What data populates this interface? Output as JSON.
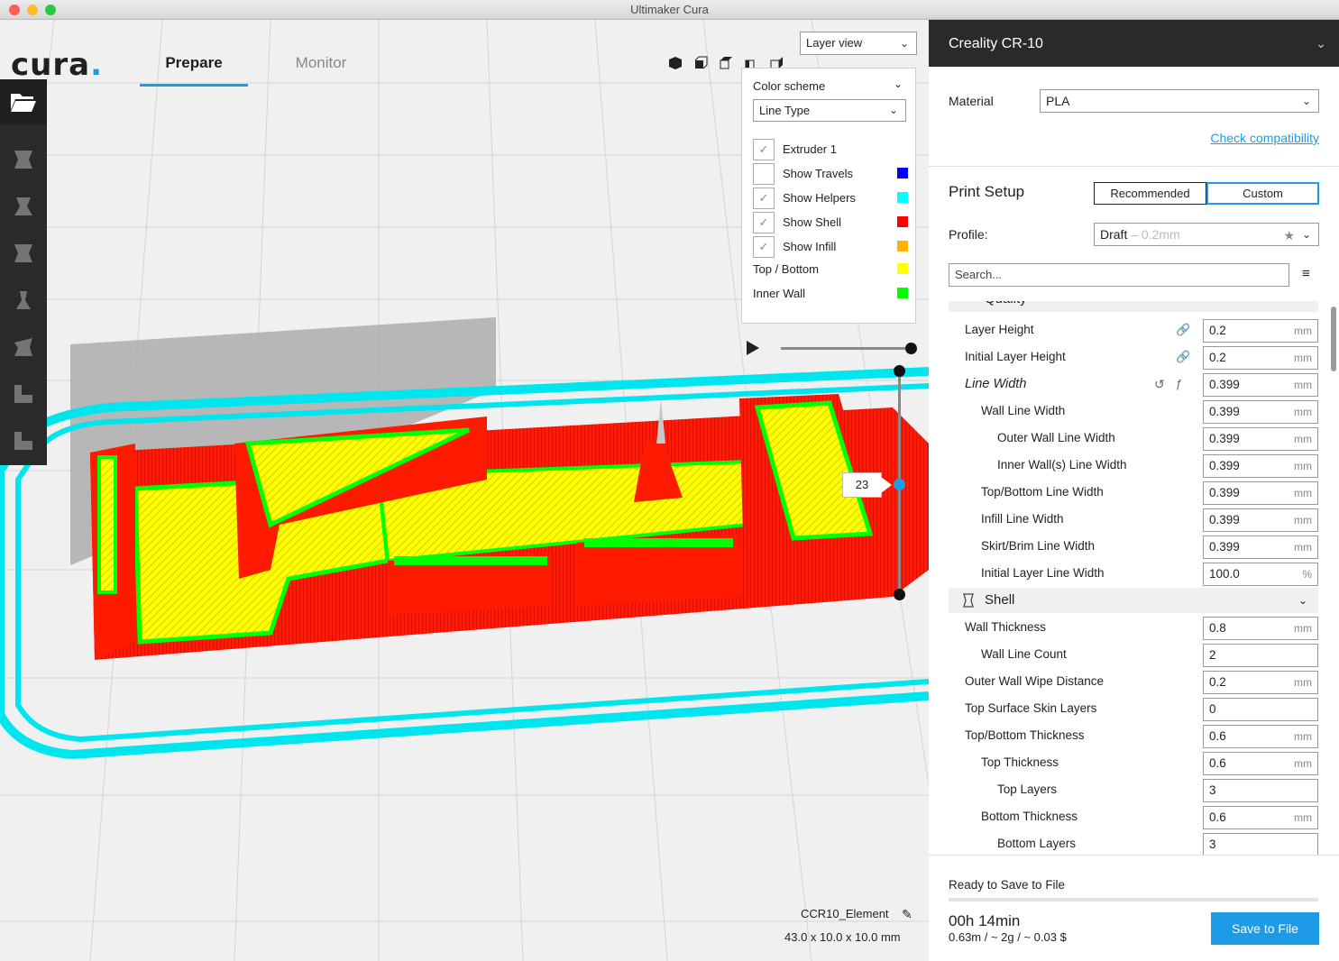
{
  "window": {
    "title": "Ultimaker Cura"
  },
  "header": {
    "logo": "cura",
    "logo_dot": ".",
    "tabs": [
      {
        "label": "Prepare"
      },
      {
        "label": "Monitor"
      }
    ],
    "view_select": "Layer view"
  },
  "color_scheme": {
    "title": "Color scheme",
    "selected": "Line Type",
    "items": [
      {
        "label": "Extruder 1",
        "checked": true
      },
      {
        "label": "Show Travels",
        "checked": false,
        "color": "#0000ff"
      },
      {
        "label": "Show Helpers",
        "checked": true,
        "color": "#00ffff"
      },
      {
        "label": "Show Shell",
        "checked": true,
        "color": "#ff0000"
      },
      {
        "label": "Show Infill",
        "checked": true,
        "color": "#ffb400"
      }
    ],
    "legend": [
      {
        "label": "Top / Bottom",
        "color": "#ffff00"
      },
      {
        "label": "Inner Wall",
        "color": "#00ff00"
      }
    ]
  },
  "layer": {
    "current": "23"
  },
  "object": {
    "name": "CCR10_Element",
    "dimensions": "43.0 x 10.0 x 10.0 mm"
  },
  "sidebar": {
    "printer": "Creality CR-10",
    "material_label": "Material",
    "material": "PLA",
    "check_compat": "Check compatibility",
    "print_setup": "Print Setup",
    "mode_recommended": "Recommended",
    "mode_custom": "Custom",
    "profile_label": "Profile:",
    "profile": "Draft",
    "profile_sub": " – 0.2mm",
    "search_placeholder": "Search...",
    "quality_label": "Quality",
    "shell_label": "Shell",
    "settings": [
      {
        "label": "Layer Height",
        "value": "0.2",
        "unit": "mm"
      },
      {
        "label": "Initial Layer Height",
        "value": "0.2",
        "unit": "mm"
      },
      {
        "label": "Line Width",
        "value": "0.399",
        "unit": "mm"
      },
      {
        "label": "Wall Line Width",
        "value": "0.399",
        "unit": "mm"
      },
      {
        "label": "Outer Wall Line Width",
        "value": "0.399",
        "unit": "mm"
      },
      {
        "label": "Inner Wall(s) Line Width",
        "value": "0.399",
        "unit": "mm"
      },
      {
        "label": "Top/Bottom Line Width",
        "value": "0.399",
        "unit": "mm"
      },
      {
        "label": "Infill Line Width",
        "value": "0.399",
        "unit": "mm"
      },
      {
        "label": "Skirt/Brim Line Width",
        "value": "0.399",
        "unit": "mm"
      },
      {
        "label": "Initial Layer Line Width",
        "value": "100.0",
        "unit": "%"
      }
    ],
    "shell_settings": [
      {
        "label": "Wall Thickness",
        "value": "0.8",
        "unit": "mm"
      },
      {
        "label": "Wall Line Count",
        "value": "2",
        "unit": ""
      },
      {
        "label": "Outer Wall Wipe Distance",
        "value": "0.2",
        "unit": "mm"
      },
      {
        "label": "Top Surface Skin Layers",
        "value": "0",
        "unit": ""
      },
      {
        "label": "Top/Bottom Thickness",
        "value": "0.6",
        "unit": "mm"
      },
      {
        "label": "Top Thickness",
        "value": "0.6",
        "unit": "mm"
      },
      {
        "label": "Top Layers",
        "value": "3",
        "unit": ""
      },
      {
        "label": "Bottom Thickness",
        "value": "0.6",
        "unit": "mm"
      },
      {
        "label": "Bottom Layers",
        "value": "3",
        "unit": ""
      }
    ],
    "ready_label": "Ready to Save to File",
    "print_time": "00h 14min",
    "print_stats": "0.63m / ~ 2g / ~ 0.03 $",
    "save_button": "Save to File"
  },
  "colors": {
    "accent": "#1e9be6",
    "shell": "#ff0000",
    "infill": "#ffff00",
    "inner_wall": "#00ff00",
    "helpers": "#00ffff"
  }
}
